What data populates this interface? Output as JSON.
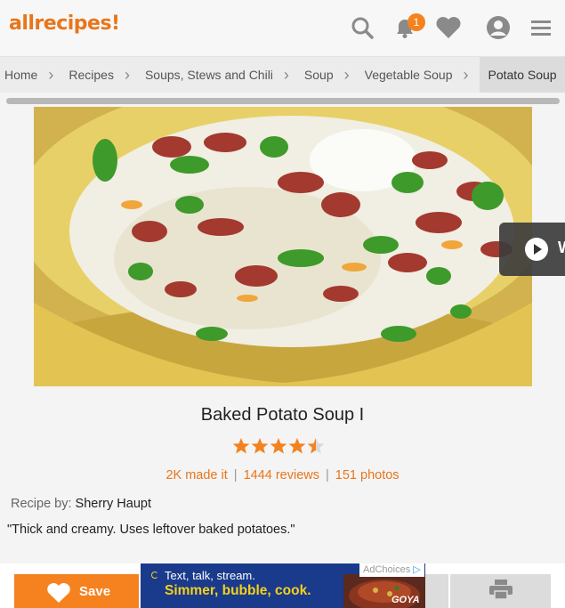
{
  "header": {
    "logo": "allrecipes",
    "notification_count": "1"
  },
  "breadcrumb": {
    "items": [
      "Home",
      "Recipes",
      "Soups, Stews and Chili",
      "Soup",
      "Vegetable Soup",
      "Potato Soup"
    ]
  },
  "media": {
    "watch_label": "W"
  },
  "recipe": {
    "title": "Baked Potato Soup I",
    "rating": 4.5,
    "made_it": "2K made it",
    "reviews": "1444 reviews",
    "photos": "151 photos",
    "byline_label": "Recipe by:",
    "author": "Sherry Haupt",
    "description": "\"Thick and creamy. Uses leftover baked potatoes.\""
  },
  "actions": {
    "save_label": "Save"
  },
  "ad": {
    "line1": "Text, talk, stream.",
    "line2": "Simmer, bubble, cook.",
    "adchoices": "AdChoices",
    "brand": "GOYA"
  },
  "colors": {
    "accent": "#f5821f",
    "star": "#f5821f"
  }
}
